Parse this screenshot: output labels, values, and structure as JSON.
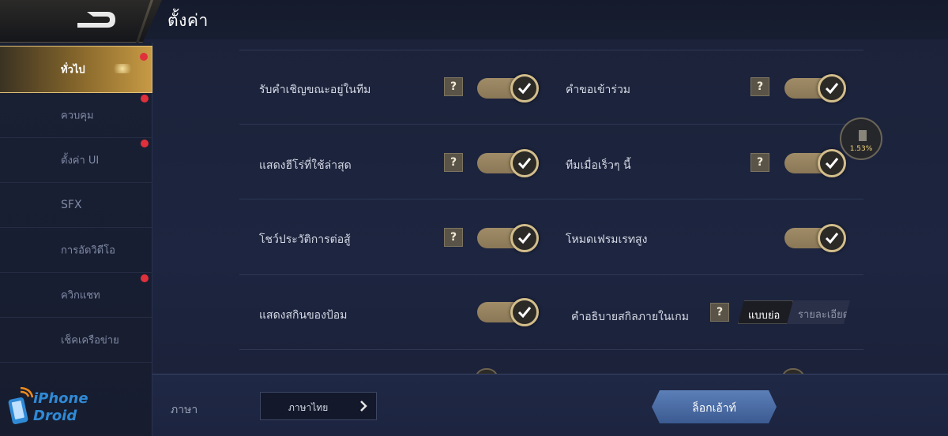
{
  "header": {
    "title": "ตั้งค่า",
    "back_icon": "back-arrow-icon"
  },
  "sidebar": {
    "items": [
      {
        "label": "ทั่วไป",
        "active": true,
        "badge": true
      },
      {
        "label": "ควบคุม",
        "active": false,
        "badge": true
      },
      {
        "label": "ตั้งค่า UI",
        "active": false,
        "badge": true
      },
      {
        "label": "SFX",
        "active": false,
        "badge": false
      },
      {
        "label": "การอัดวิดีโอ",
        "active": false,
        "badge": false
      },
      {
        "label": "ควิกแชท",
        "active": false,
        "badge": true
      },
      {
        "label": "เช็คเครือข่าย",
        "active": false,
        "badge": false
      }
    ]
  },
  "settings": {
    "help_symbol": "?",
    "rows": [
      {
        "left": {
          "label": "รับคำเชิญขณะอยู่ในทีม",
          "help": true,
          "on": true
        },
        "right": {
          "label": "คำขอเข้าร่วม",
          "help": true,
          "on": true
        }
      },
      {
        "left": {
          "label": "แสดงฮีโร่ที่ใช้ล่าสุด",
          "help": true,
          "on": true
        },
        "right": {
          "label": "ทีมเมื่อเร็วๆ นี้",
          "help": true,
          "on": true
        }
      },
      {
        "left": {
          "label": "โชว์ประวัติการต่อสู้",
          "help": true,
          "on": true
        },
        "right": {
          "label": "โหมดเฟรมเรทสูง",
          "help": false,
          "on": true
        }
      },
      {
        "left": {
          "label": "แสดงสกินของป้อม",
          "help": false,
          "on": true
        },
        "right": {
          "label": "คำอธิบายสกิลภายในเกม",
          "help": true,
          "options": [
            "แบบย่อ",
            "รายละเอียด"
          ],
          "selected": "แบบย่อ"
        }
      }
    ]
  },
  "footer": {
    "language_label": "ภาษา",
    "language_value": "ภาษาไทย",
    "logout_label": "ล็อกเอ้าท์"
  },
  "overlay": {
    "ping_percent": "1.53%"
  },
  "watermark": {
    "line1": "iPhone",
    "line2": "Droid"
  },
  "colors": {
    "accent_gold": "#d2bd8c",
    "badge_red": "#e0303c",
    "logout_blue": "#4a6ca6",
    "background": "#1b2239"
  }
}
